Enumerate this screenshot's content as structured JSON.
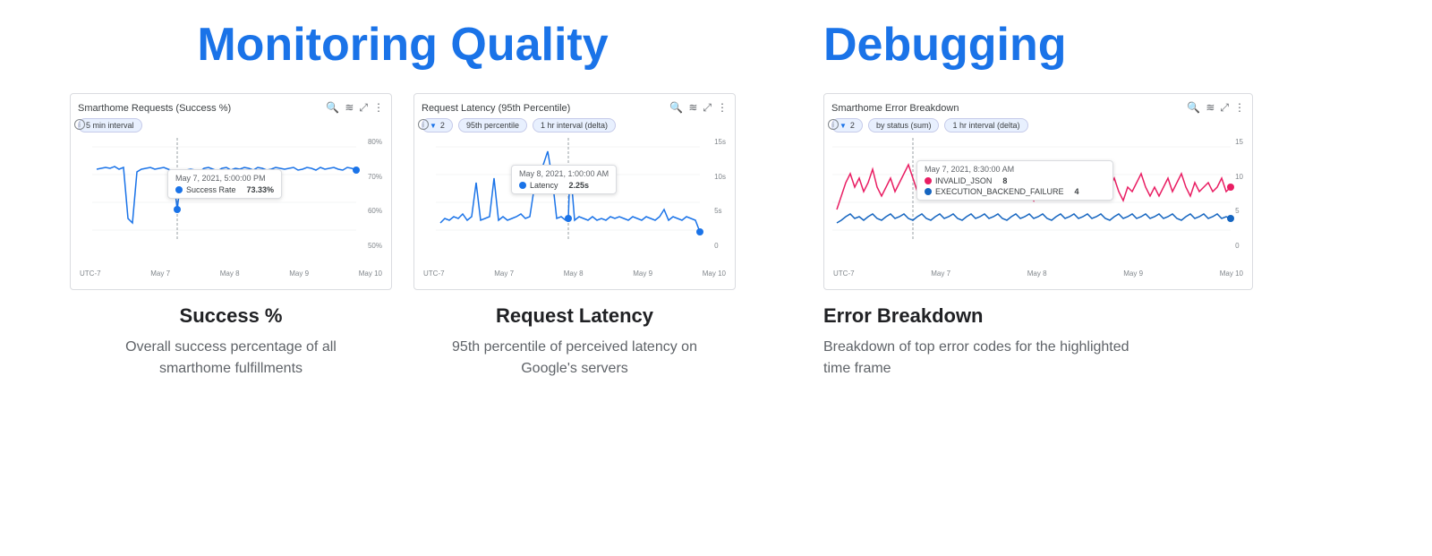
{
  "page": {
    "left_title": "Monitoring Quality",
    "right_title": "Debugging"
  },
  "cards": [
    {
      "id": "success",
      "chart_title": "Smarthome Requests (Success %)",
      "filters": [
        "5 min interval"
      ],
      "filter_icons": [
        false
      ],
      "tooltip": {
        "date": "May 7, 2021, 5:00:00 PM",
        "metric": "Success Rate",
        "value": "73.33%",
        "color": "#1a73e8"
      },
      "y_axis": [
        "80%",
        "70%",
        "60%",
        "50%"
      ],
      "x_axis": [
        "UTC-7",
        "May 7",
        "May 8",
        "May 9",
        "May 10"
      ],
      "label": "Success %",
      "desc": "Overall success percentage of all smarthome fulfillments"
    },
    {
      "id": "latency",
      "chart_title": "Request Latency (95th Percentile)",
      "filters": [
        "2",
        "95th percentile",
        "1 hr interval (delta)"
      ],
      "filter_icons": [
        true,
        false,
        false
      ],
      "tooltip": {
        "date": "May 8, 2021, 1:00:00 AM",
        "metric": "Latency",
        "value": "2.25s",
        "color": "#1a73e8"
      },
      "y_axis": [
        "15s",
        "10s",
        "5s",
        "0"
      ],
      "x_axis": [
        "UTC-7",
        "May 7",
        "May 8",
        "May 9",
        "May 10"
      ],
      "label": "Request Latency",
      "desc": "95th percentile of perceived latency on Google's servers"
    }
  ],
  "right_card": {
    "chart_title": "Smarthome Error Breakdown",
    "filters": [
      "2",
      "by status (sum)",
      "1 hr interval (delta)"
    ],
    "filter_icons": [
      true,
      false,
      false
    ],
    "tooltip": {
      "date": "May 7, 2021, 8:30:00 AM",
      "entries": [
        {
          "label": "INVALID_JSON",
          "value": "8",
          "color": "#e91e63"
        },
        {
          "label": "EXECUTION_BACKEND_FAILURE",
          "value": "4",
          "color": "#1565c0"
        }
      ]
    },
    "y_axis": [
      "15",
      "10",
      "5",
      "0"
    ],
    "x_axis": [
      "UTC-7",
      "May 7",
      "May 8",
      "May 9",
      "May 10"
    ],
    "label": "Error Breakdown",
    "desc": "Breakdown of top error codes for the highlighted time frame"
  }
}
